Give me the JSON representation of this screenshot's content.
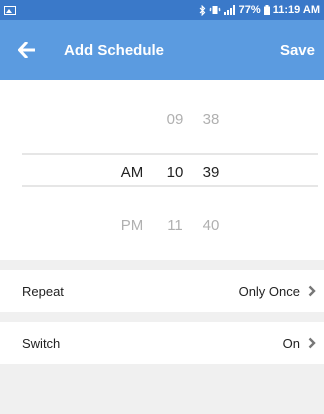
{
  "status_bar": {
    "battery_percent": "77%",
    "time": "11:19 AM",
    "icons": [
      "image-icon",
      "bluetooth-icon",
      "vibrate-icon",
      "signal-icon",
      "battery-icon"
    ]
  },
  "app_bar": {
    "title": "Add Schedule",
    "save_label": "Save",
    "back_icon": "arrow-left-icon"
  },
  "picker": {
    "rows": [
      {
        "ampm": "",
        "hour": "09",
        "minute": "38"
      },
      {
        "ampm": "AM",
        "hour": "10",
        "minute": "39"
      },
      {
        "ampm": "PM",
        "hour": "11",
        "minute": "40"
      }
    ]
  },
  "settings": {
    "repeat": {
      "label": "Repeat",
      "value": "Only Once"
    },
    "switch": {
      "label": "Switch",
      "value": "On"
    }
  },
  "colors": {
    "app_bar": "#5b9be0",
    "status_bar": "#3a79c9",
    "background": "#f0f0f0"
  }
}
